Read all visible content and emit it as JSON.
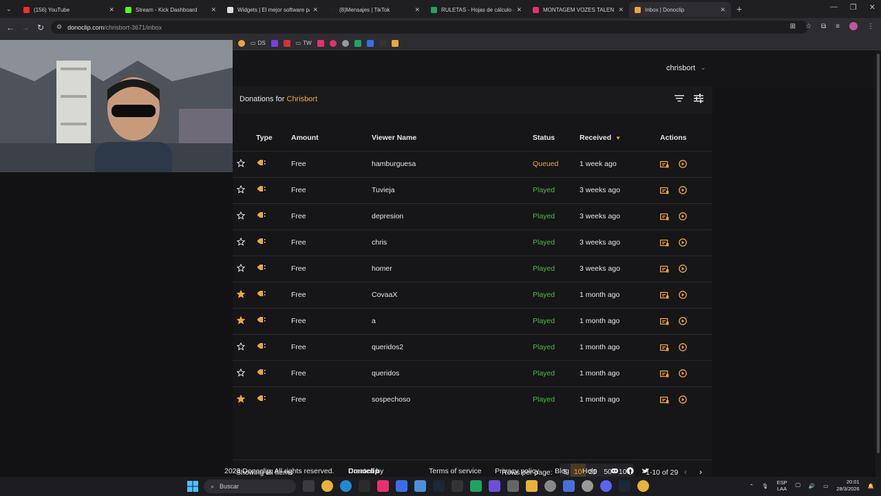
{
  "browser": {
    "tabs": [
      {
        "title": "(156) YouTube",
        "color": "#ff2a2a",
        "active": false
      },
      {
        "title": "Stream - Kick Dashboard",
        "color": "#53fc18",
        "active": false
      },
      {
        "title": "Widgets | El mejor software pa",
        "color": "#dddddd",
        "active": false
      },
      {
        "title": "(8)Mensajes | TikTok",
        "color": "#222222",
        "active": false
      },
      {
        "title": "RULETAS - Hojas de cálculo de",
        "color": "#1ea362",
        "active": false
      },
      {
        "title": "MONTAGEM VOZES TALEN",
        "color": "#e5316e",
        "active": false
      },
      {
        "title": "Inbox | Donoclip",
        "color": "#f0a53a",
        "active": true
      }
    ],
    "url_host": "donoclip.com",
    "url_path": "/chrisbort-3671/inbox",
    "bookmarks": [
      {
        "label": "DS",
        "color": "#f0a53a"
      },
      {
        "label": "TW",
        "color": "#cccccc"
      }
    ]
  },
  "header": {
    "username": "chrisbort"
  },
  "panel": {
    "title_prefix": "Donations for",
    "channel": "Chrisbort"
  },
  "table": {
    "headers": {
      "type": "Type",
      "amount": "Amount",
      "viewer": "Viewer Name",
      "status": "Status",
      "received": "Received",
      "actions": "Actions"
    },
    "rows": [
      {
        "starred": false,
        "amount": "Free",
        "viewer": "hamburguesa",
        "status": "Queued",
        "received": "1 week ago"
      },
      {
        "starred": false,
        "amount": "Free",
        "viewer": "Tuvieja",
        "status": "Played",
        "received": "3 weeks ago"
      },
      {
        "starred": false,
        "amount": "Free",
        "viewer": "depresion",
        "status": "Played",
        "received": "3 weeks ago"
      },
      {
        "starred": false,
        "amount": "Free",
        "viewer": "chris",
        "status": "Played",
        "received": "3 weeks ago"
      },
      {
        "starred": false,
        "amount": "Free",
        "viewer": "homer",
        "status": "Played",
        "received": "3 weeks ago"
      },
      {
        "starred": true,
        "amount": "Free",
        "viewer": "CovaaX",
        "status": "Played",
        "received": "1 month ago"
      },
      {
        "starred": true,
        "amount": "Free",
        "viewer": "a",
        "status": "Played",
        "received": "1 month ago"
      },
      {
        "starred": false,
        "amount": "Free",
        "viewer": "queridos2",
        "status": "Played",
        "received": "1 month ago"
      },
      {
        "starred": false,
        "amount": "Free",
        "viewer": "queridos",
        "status": "Played",
        "received": "1 month ago"
      },
      {
        "starred": true,
        "amount": "Free",
        "viewer": "sospechoso",
        "status": "Played",
        "received": "1 month ago"
      }
    ]
  },
  "pagination": {
    "showing": "Showing all Items",
    "rows_per_page_label": "Rows per page:",
    "options": [
      "5",
      "10",
      "25",
      "50",
      "100"
    ],
    "selected": "10",
    "range": "1-10 of 29"
  },
  "footer": {
    "copyright": "2023 Donoclip. All rights reserved.",
    "created_by": "Created by",
    "created_by_brand": "Donoclip",
    "terms": "Terms of service",
    "privacy": "Privacy policy",
    "blog": "Blog",
    "help": "Help"
  },
  "taskbar": {
    "search_placeholder": "Buscar",
    "lang_top": "ESP",
    "lang_bottom": "LAA",
    "time": "20:01",
    "date": "28/3/2026"
  },
  "colors": {
    "accent": "#f0a53a",
    "played": "#4fbb47",
    "queued": "#f0a53a"
  }
}
